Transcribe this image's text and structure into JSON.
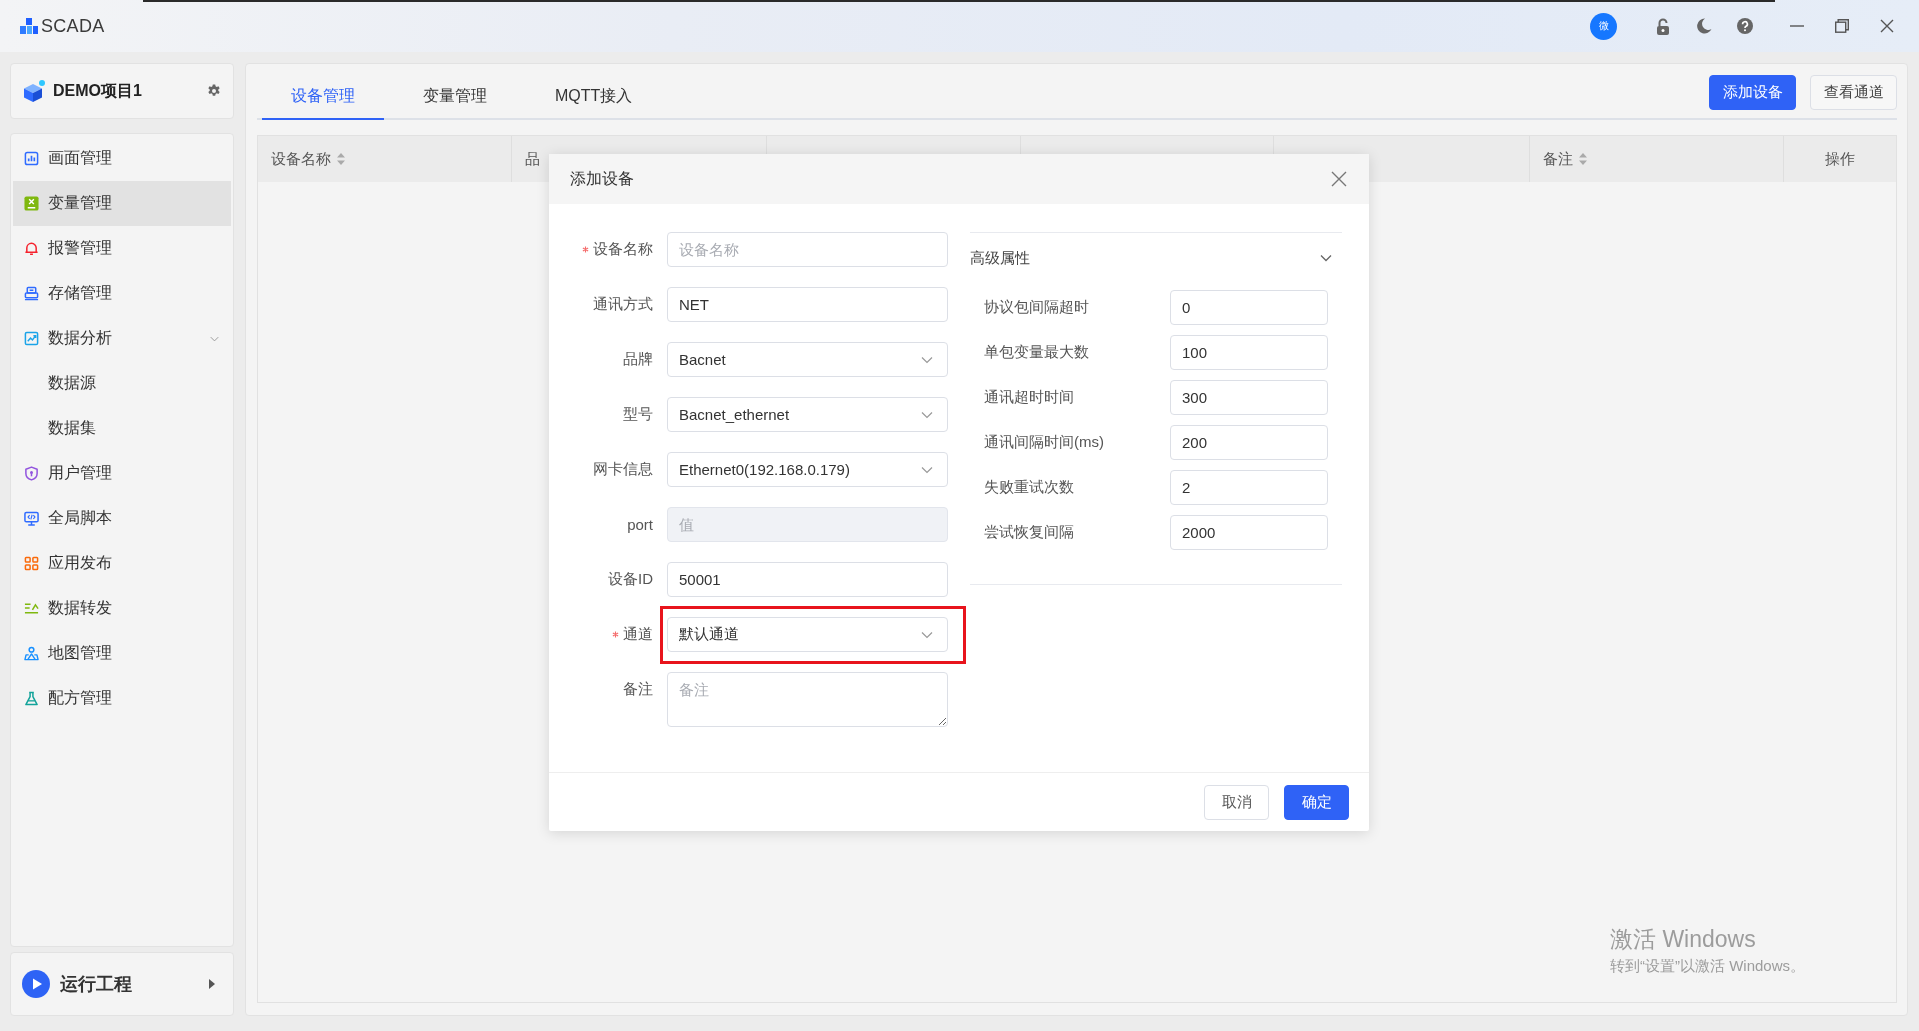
{
  "app": {
    "title": "SCADA",
    "avatar_text": "微"
  },
  "project": {
    "name": "DEMO项目1"
  },
  "sidebar": {
    "items": [
      {
        "label": "画面管理",
        "selected": false
      },
      {
        "label": "变量管理",
        "selected": true
      },
      {
        "label": "报警管理",
        "selected": false
      },
      {
        "label": "存储管理",
        "selected": false
      },
      {
        "label": "数据分析",
        "selected": false,
        "expanded": true,
        "children": [
          {
            "label": "数据源",
            "selected": false
          },
          {
            "label": "数据集",
            "selected": false
          }
        ]
      },
      {
        "label": "用户管理",
        "selected": false
      },
      {
        "label": "全局脚本",
        "selected": false
      },
      {
        "label": "应用发布",
        "selected": false
      },
      {
        "label": "数据转发",
        "selected": false
      },
      {
        "label": "地图管理",
        "selected": false
      },
      {
        "label": "配方管理",
        "selected": false
      }
    ]
  },
  "run_button": {
    "label": "运行工程"
  },
  "tabs": [
    {
      "label": "设备管理",
      "selected": true
    },
    {
      "label": "变量管理",
      "selected": false
    },
    {
      "label": "MQTT接入",
      "selected": false
    }
  ],
  "toolbar_buttons": [
    {
      "label": "添加设备",
      "kind": "primary"
    },
    {
      "label": "查看通道",
      "kind": "default"
    }
  ],
  "table": {
    "columns_left": [
      {
        "label": "设备名称",
        "sortable": true
      },
      {
        "label": "品",
        "sortable": false
      }
    ],
    "columns_right": [
      {
        "label": "备注",
        "sortable": true
      },
      {
        "label": "操作",
        "sortable": false
      }
    ]
  },
  "dialog": {
    "title": "添加设备",
    "fields": [
      {
        "label": "设备名称",
        "kind": "input",
        "required": true,
        "placeholder": "设备名称",
        "disabled": false,
        "highlighted": false
      },
      {
        "label": "通讯方式",
        "kind": "input",
        "required": false,
        "value": "NET",
        "disabled": false,
        "highlighted": false
      },
      {
        "label": "品牌",
        "kind": "select",
        "required": false,
        "value": "Bacnet",
        "disabled": false,
        "highlighted": false
      },
      {
        "label": "型号",
        "kind": "select",
        "required": false,
        "value": "Bacnet_ethernet",
        "disabled": false,
        "highlighted": false
      },
      {
        "label": "网卡信息",
        "kind": "select",
        "required": false,
        "value": "Ethernet0(192.168.0.179)",
        "disabled": false,
        "highlighted": false
      },
      {
        "label": "port",
        "kind": "input",
        "required": false,
        "placeholder": "值",
        "disabled": true,
        "highlighted": false
      },
      {
        "label": "设备ID",
        "kind": "input",
        "required": false,
        "value": "50001",
        "disabled": false,
        "highlighted": false
      },
      {
        "label": "通道",
        "kind": "select",
        "required": true,
        "value": "默认通道",
        "disabled": false,
        "highlighted": true
      },
      {
        "label": "备注",
        "kind": "textarea",
        "required": false,
        "placeholder": "备注",
        "disabled": false,
        "highlighted": false
      }
    ],
    "advanced": {
      "title": "高级属性",
      "expanded": true,
      "fields": [
        {
          "label": "协议包间隔超时",
          "value": "0"
        },
        {
          "label": "单包变量最大数",
          "value": "100"
        },
        {
          "label": "通讯超时时间",
          "value": "300"
        },
        {
          "label": "通讯间隔时间(ms)",
          "value": "200"
        },
        {
          "label": "失败重试次数",
          "value": "2"
        },
        {
          "label": "尝试恢复间隔",
          "value": "2000"
        }
      ]
    },
    "buttons": [
      {
        "label": "取消",
        "kind": "default"
      },
      {
        "label": "确定",
        "kind": "primary"
      }
    ]
  },
  "os_watermark": {
    "title": "激活 Windows",
    "subtitle": "转到“设置”以激活 Windows。"
  }
}
